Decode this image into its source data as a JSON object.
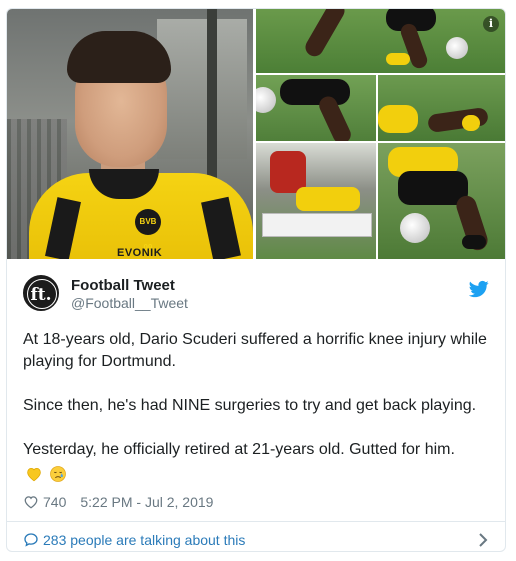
{
  "media": {
    "info_icon": "i",
    "main_photo": {
      "badge": "BVB 09",
      "sponsor": "EVONIK"
    }
  },
  "author": {
    "avatar_text": "ft.",
    "name": "Football Tweet",
    "handle": "@Football__Tweet"
  },
  "tweet": {
    "paragraphs": [
      "At 18-years old, Dario Scuderi suffered a horrific knee injury while playing for Dortmund.",
      "Since then, he's had NINE surgeries to try and get back playing.",
      "Yesterday, he officially retired at 21-years old. Gutted for him."
    ],
    "emojis": [
      "yellow-heart-emoji",
      "crying-face-emoji"
    ]
  },
  "meta": {
    "likes": "740",
    "timestamp": "5:22 PM - Jul 2, 2019"
  },
  "footer": {
    "talking_label": "283 people are talking about this"
  },
  "colors": {
    "twitter_blue": "#1da1f2",
    "link_blue": "#2b7bb9",
    "secondary_text": "#697882",
    "border": "#e1e8ed",
    "bvb_yellow": "#f5d313"
  },
  "icons": [
    "twitter-bird-icon",
    "heart-icon",
    "speech-bubble-icon",
    "chevron-right-icon",
    "info-icon"
  ]
}
